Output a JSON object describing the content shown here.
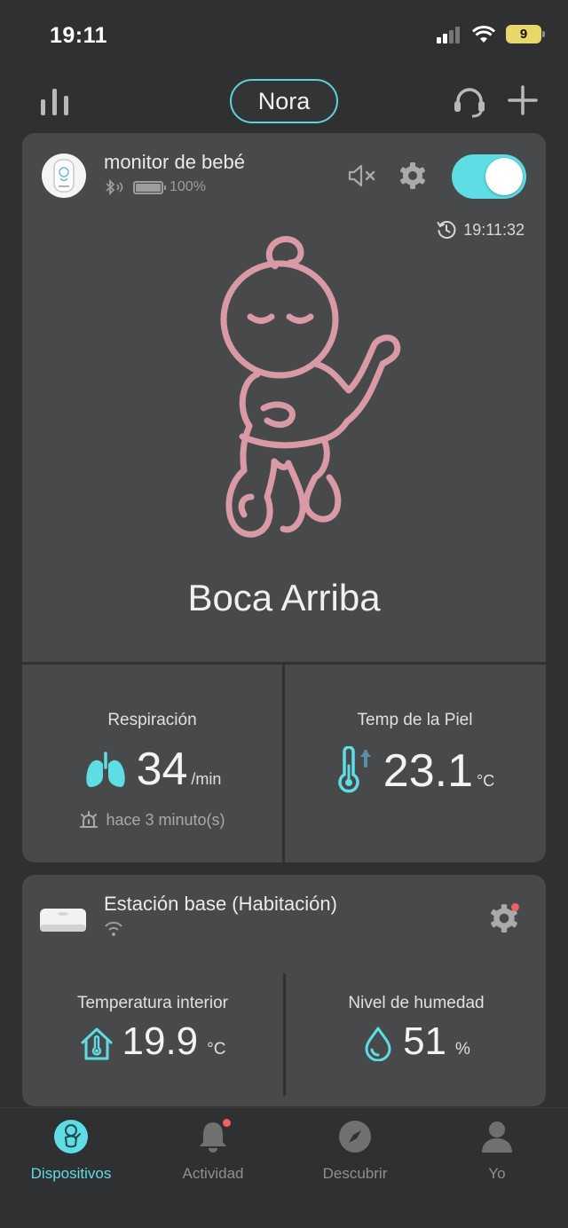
{
  "status_bar": {
    "time": "19:11",
    "battery_level": "9"
  },
  "top_bar": {
    "profile_name": "Nora"
  },
  "monitor": {
    "device_name": "monitor de bebé",
    "battery_percent": "100%",
    "toggle_on": true,
    "last_update": "19:11:32",
    "position_label": "Boca Arriba",
    "breathing": {
      "label": "Respiración",
      "value": "34",
      "unit": "/min",
      "note": "hace 3 minuto(s)"
    },
    "skin_temp": {
      "label": "Temp de la Piel",
      "value": "23.1",
      "unit": "°C"
    }
  },
  "base_station": {
    "name": "Estación base (Habitación)",
    "indoor_temp": {
      "label": "Temperatura interior",
      "value": "19.9",
      "unit": "°C"
    },
    "humidity": {
      "label": "Nivel de humedad",
      "value": "51",
      "unit": "%"
    }
  },
  "tabs": [
    {
      "label": "Dispositivos",
      "icon": "baby-device-icon",
      "active": true
    },
    {
      "label": "Actividad",
      "icon": "bell-icon",
      "active": false
    },
    {
      "label": "Descubrir",
      "icon": "compass-icon",
      "active": false
    },
    {
      "label": "Yo",
      "icon": "person-icon",
      "active": false
    }
  ],
  "colors": {
    "accent": "#5fdde4",
    "baby": "#d99aa5",
    "card": "#48494b",
    "background": "#2f3032",
    "alert": "#f06060"
  }
}
